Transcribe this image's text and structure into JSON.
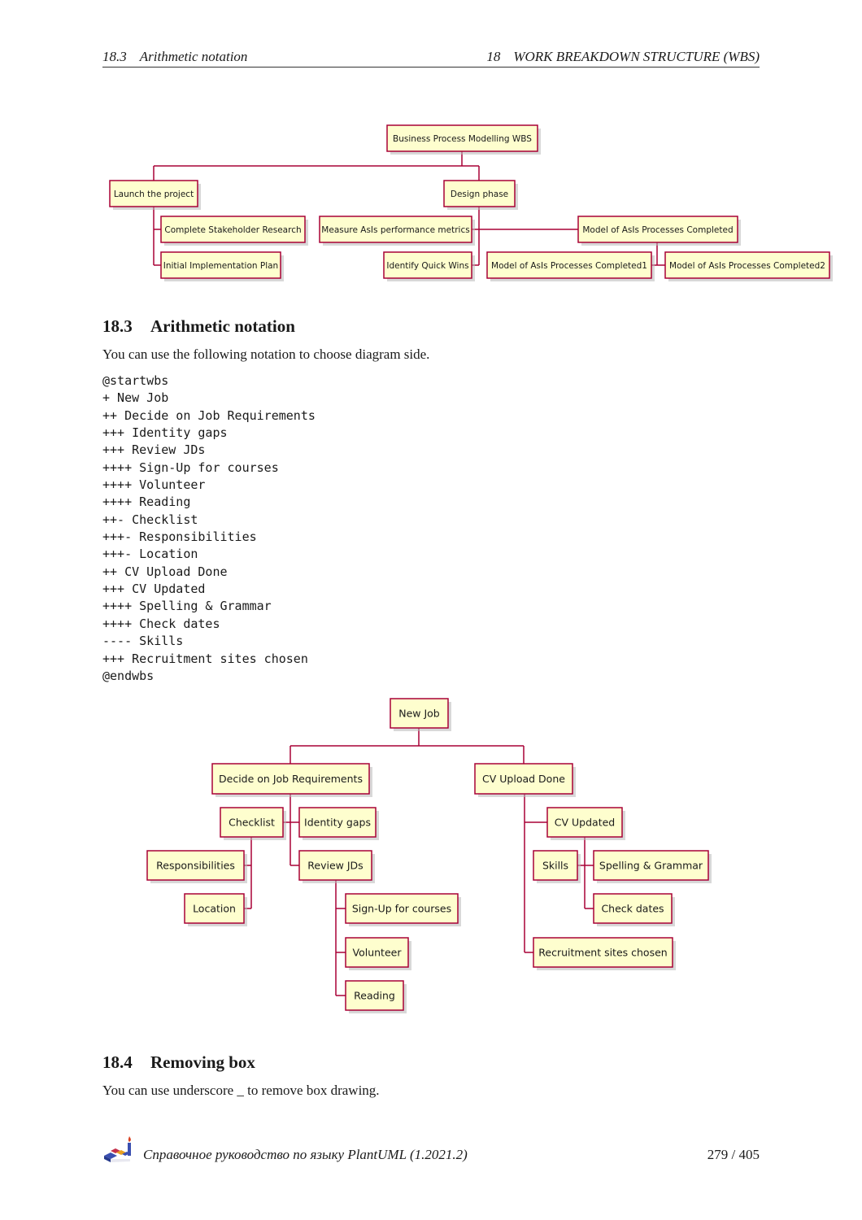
{
  "header": {
    "section_number": "18.3",
    "section_title": "Arithmetic notation",
    "chapter_number": "18",
    "chapter_title": "WORK BREAKDOWN STRUCTURE (WBS)"
  },
  "colors": {
    "node_fill": "#fefece",
    "node_border": "#a80036",
    "edge": "#a80036"
  },
  "diagram1": {
    "nodes": [
      {
        "id": "root",
        "label": "Business Process Modelling WBS"
      },
      {
        "id": "launch",
        "label": "Launch the project"
      },
      {
        "id": "design",
        "label": "Design phase"
      },
      {
        "id": "stakeholder",
        "label": "Complete Stakeholder Research"
      },
      {
        "id": "initial",
        "label": "Initial Implementation Plan"
      },
      {
        "id": "measure",
        "label": "Measure AsIs performance metrics"
      },
      {
        "id": "quickwins",
        "label": "Identify Quick Wins"
      },
      {
        "id": "model",
        "label": "Model of AsIs Processes Completed"
      },
      {
        "id": "model1",
        "label": "Model of AsIs Processes Completed1"
      },
      {
        "id": "model2",
        "label": "Model of AsIs Processes Completed2"
      }
    ]
  },
  "section_18_3": {
    "number": "18.3",
    "title": "Arithmetic notation",
    "intro": "You can use the following notation to choose diagram side.",
    "code_lines": [
      "@startwbs",
      "+ New Job",
      "++ Decide on Job Requirements",
      "+++ Identity gaps",
      "+++ Review JDs",
      "++++ Sign-Up for courses",
      "++++ Volunteer",
      "++++ Reading",
      "++- Checklist",
      "+++- Responsibilities",
      "+++- Location",
      "++ CV Upload Done",
      "+++ CV Updated",
      "++++ Spelling & Grammar",
      "++++ Check dates",
      "---- Skills",
      "+++ Recruitment sites chosen",
      "@endwbs"
    ]
  },
  "diagram2": {
    "nodes": [
      {
        "id": "newjob",
        "label": "New Job"
      },
      {
        "id": "decide",
        "label": "Decide on Job Requirements"
      },
      {
        "id": "cvupload",
        "label": "CV Upload Done"
      },
      {
        "id": "checklist",
        "label": "Checklist"
      },
      {
        "id": "identity",
        "label": "Identity gaps"
      },
      {
        "id": "resp",
        "label": "Responsibilities"
      },
      {
        "id": "review",
        "label": "Review JDs"
      },
      {
        "id": "location",
        "label": "Location"
      },
      {
        "id": "signup",
        "label": "Sign-Up for courses"
      },
      {
        "id": "volunteer",
        "label": "Volunteer"
      },
      {
        "id": "reading",
        "label": "Reading"
      },
      {
        "id": "cvupdated",
        "label": "CV Updated"
      },
      {
        "id": "skills",
        "label": "Skills"
      },
      {
        "id": "spelling",
        "label": "Spelling & Grammar"
      },
      {
        "id": "checkdates",
        "label": "Check dates"
      },
      {
        "id": "recruit",
        "label": "Recruitment sites chosen"
      }
    ]
  },
  "section_18_4": {
    "number": "18.4",
    "title": "Removing box",
    "intro": "You can use underscore _ to remove box drawing."
  },
  "footer": {
    "logo_icon": "plantuml-logo-icon",
    "title": "Справочное руководство по языку PlantUML (1.2021.2)",
    "page": "279 / 405"
  }
}
